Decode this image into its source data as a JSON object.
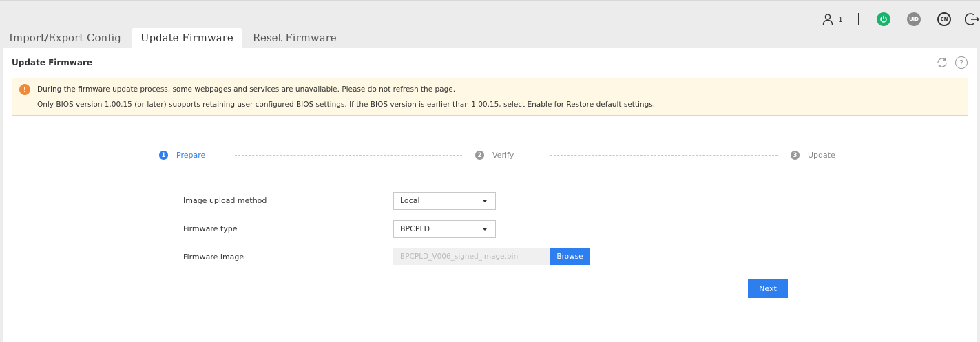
{
  "header": {
    "user_count": "1",
    "uid_label": "UID",
    "lang_label": "CN"
  },
  "tabs": [
    {
      "label": "Import/Export Config"
    },
    {
      "label": "Update Firmware"
    },
    {
      "label": "Reset Firmware"
    }
  ],
  "panel": {
    "title": "Update Firmware",
    "help_glyph": "?"
  },
  "notice": {
    "icon_glyph": "!",
    "line1": "During the firmware update process, some webpages and services are unavailable. Please do not refresh the page.",
    "line2": "Only BIOS version 1.00.15 (or later) supports retaining user configured BIOS settings. If the BIOS version is earlier than 1.00.15, select Enable for Restore default settings."
  },
  "steps": [
    {
      "num": "1",
      "label": "Prepare"
    },
    {
      "num": "2",
      "label": "Verify"
    },
    {
      "num": "3",
      "label": "Update"
    }
  ],
  "form": {
    "upload_method_label": "Image upload method",
    "upload_method_value": "Local",
    "firmware_type_label": "Firmware type",
    "firmware_type_value": "BPCPLD",
    "firmware_image_label": "Firmware image",
    "firmware_image_value": "BPCPLD_V006_signed_image.bin",
    "browse_label": "Browse",
    "next_label": "Next"
  },
  "colors": {
    "accent": "#2d7ff0",
    "power": "#19b46b",
    "warning": "#f08a3a",
    "notice_bg": "#fff8e4"
  }
}
